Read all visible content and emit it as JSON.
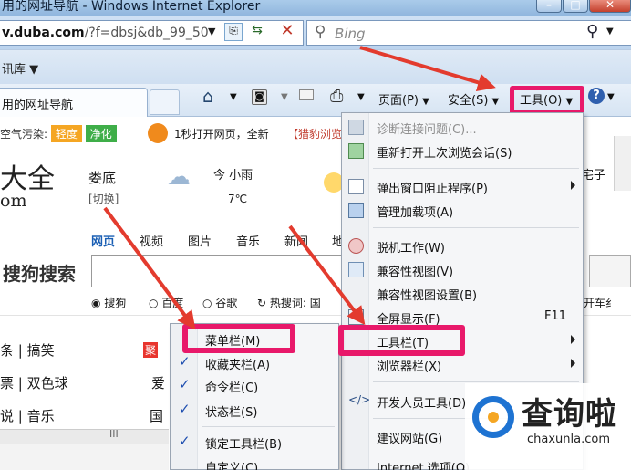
{
  "window": {
    "title": "用的网址导航 - Windows Internet Explorer"
  },
  "address_bar": {
    "url_bold": "v.duba.com",
    "url_rest": "/?f=dbsj&db_99_50",
    "search_placeholder": "Bing"
  },
  "favorites_bar": {
    "feed_label": "讯库 ▼"
  },
  "tab": {
    "title": "用的网址导航"
  },
  "command_bar": {
    "page_label": "页面(P)",
    "safety_label": "安全(S)",
    "tools_label": "工具(O)"
  },
  "page": {
    "air_label": "空气污染:",
    "air_level": "轻度",
    "air_filter": "净化",
    "promo_text": "1秒打开网页，全新",
    "promo_brand": "【猎豹浏览",
    "logo_text": "大全",
    "logo_sub": "om",
    "city": "娄底",
    "switch_city": "[切换]",
    "weather_today": "今 小雨",
    "temp": "7℃",
    "right_snip": "宅子",
    "search_tabs": [
      "网页",
      "视频",
      "图片",
      "音乐",
      "新闻",
      "地"
    ],
    "search_brand": "搜狗搜索",
    "engines": [
      "搜狗",
      "百度",
      "谷歌"
    ],
    "hot_search": "热搜词: 国",
    "right_snip2": "开车纟",
    "left_links": [
      "条 | 搞笑",
      "票 | 双色球",
      "说 | 音乐"
    ],
    "mid_links": [
      "聚",
      "爱",
      "国"
    ]
  },
  "tools_menu": {
    "items": [
      {
        "label": "诊断连接问题(C)...",
        "disabled": true,
        "icon": "diagnose-icon"
      },
      {
        "label": "重新打开上次浏览会话(S)",
        "icon": "reopen-icon"
      },
      {
        "label": "弹出窗口阻止程序(P)",
        "submenu": true,
        "icon": "popup-blocker-icon"
      },
      {
        "label": "管理加载项(A)",
        "icon": "addons-icon"
      },
      {
        "label": "脱机工作(W)",
        "icon": "offline-icon"
      },
      {
        "label": "兼容性视图(V)",
        "icon": "compat-view-icon"
      },
      {
        "label": "兼容性视图设置(B)"
      },
      {
        "label": "全屏显示(F)",
        "shortcut": "F11",
        "icon": "fullscreen-icon"
      },
      {
        "label": "工具栏(T)",
        "submenu": true
      },
      {
        "label": "浏览器栏(X)",
        "submenu": true
      },
      {
        "label": "开发人员工具(D)",
        "icon": "dev-tools-icon"
      },
      {
        "label": "建议网站(G)"
      },
      {
        "label": "Internet 选项(O)"
      }
    ]
  },
  "toolbars_submenu": {
    "items": [
      {
        "label": "菜单栏(M)",
        "checked": false
      },
      {
        "label": "收藏夹栏(A)",
        "checked": true
      },
      {
        "label": "命令栏(C)",
        "checked": true
      },
      {
        "label": "状态栏(S)",
        "checked": true
      },
      {
        "label": "锁定工具栏(B)",
        "checked": true
      },
      {
        "label": "自定义(C)..."
      }
    ]
  },
  "watermark": {
    "brand": "查询啦",
    "url": "chaxunla.com"
  },
  "colors": {
    "highlight": "#e8196a",
    "arrow": "#e33b2e",
    "titlebar": "#aacbea",
    "check": "#1f4fb0"
  }
}
